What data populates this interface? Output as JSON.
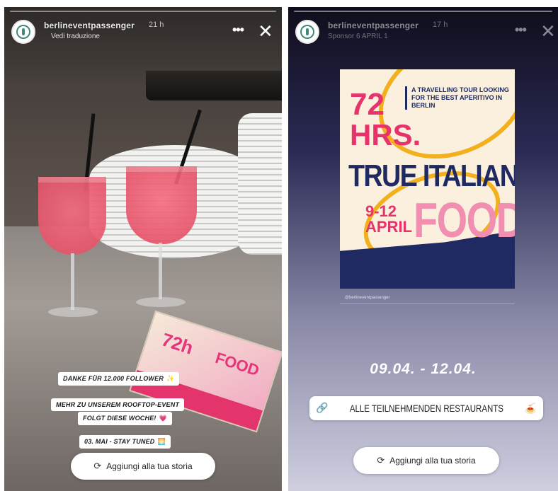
{
  "left_story": {
    "username": "berlineventpassenger",
    "time": "21 h",
    "subtitle": "Vedi traduzione",
    "more_label": "•••",
    "close_label": "✕",
    "captions": [
      {
        "text": "DANKE FÜR 12.000 FOLLOWER",
        "emoji": "✨"
      },
      {
        "text": "MEHR ZU UNSEREM ROOFTOP-EVENT",
        "emoji": ""
      },
      {
        "text": "FOLGT DIESE WOCHE!",
        "emoji": "💗"
      },
      {
        "text": "03. MAI - STAY TUNED",
        "emoji": "🌅"
      }
    ],
    "flyer_text_a": "72h",
    "flyer_text_b": "FOOD",
    "add_story_label": "Aggiungi alla tua storia"
  },
  "right_story": {
    "username": "berlineventpassenger",
    "time": "17 h",
    "subtitle": "Sponsor 6 APRIL 1",
    "more_label": "•••",
    "close_label": "✕",
    "poster": {
      "big_number": "72",
      "hrs": "HRS.",
      "tagline": "A TRAVELLING TOUR LOOKING FOR THE BEST APERITIVO IN BERLIN",
      "headline": "TRUE ITALIAN",
      "date_range": "9-12 APRIL",
      "food": "FOOD"
    },
    "poster_credit": "@berlineventpassenger",
    "dates_text": "09.04. - 12.04.",
    "restaurants_label": "ALLE TEILNEHMENDEN RESTAURANTS",
    "restaurants_emoji": "🍝",
    "link_icon_glyph": "🔗",
    "add_story_label": "Aggiungi alla tua storia"
  },
  "icons": {
    "add_story_glyph": "⟳"
  }
}
